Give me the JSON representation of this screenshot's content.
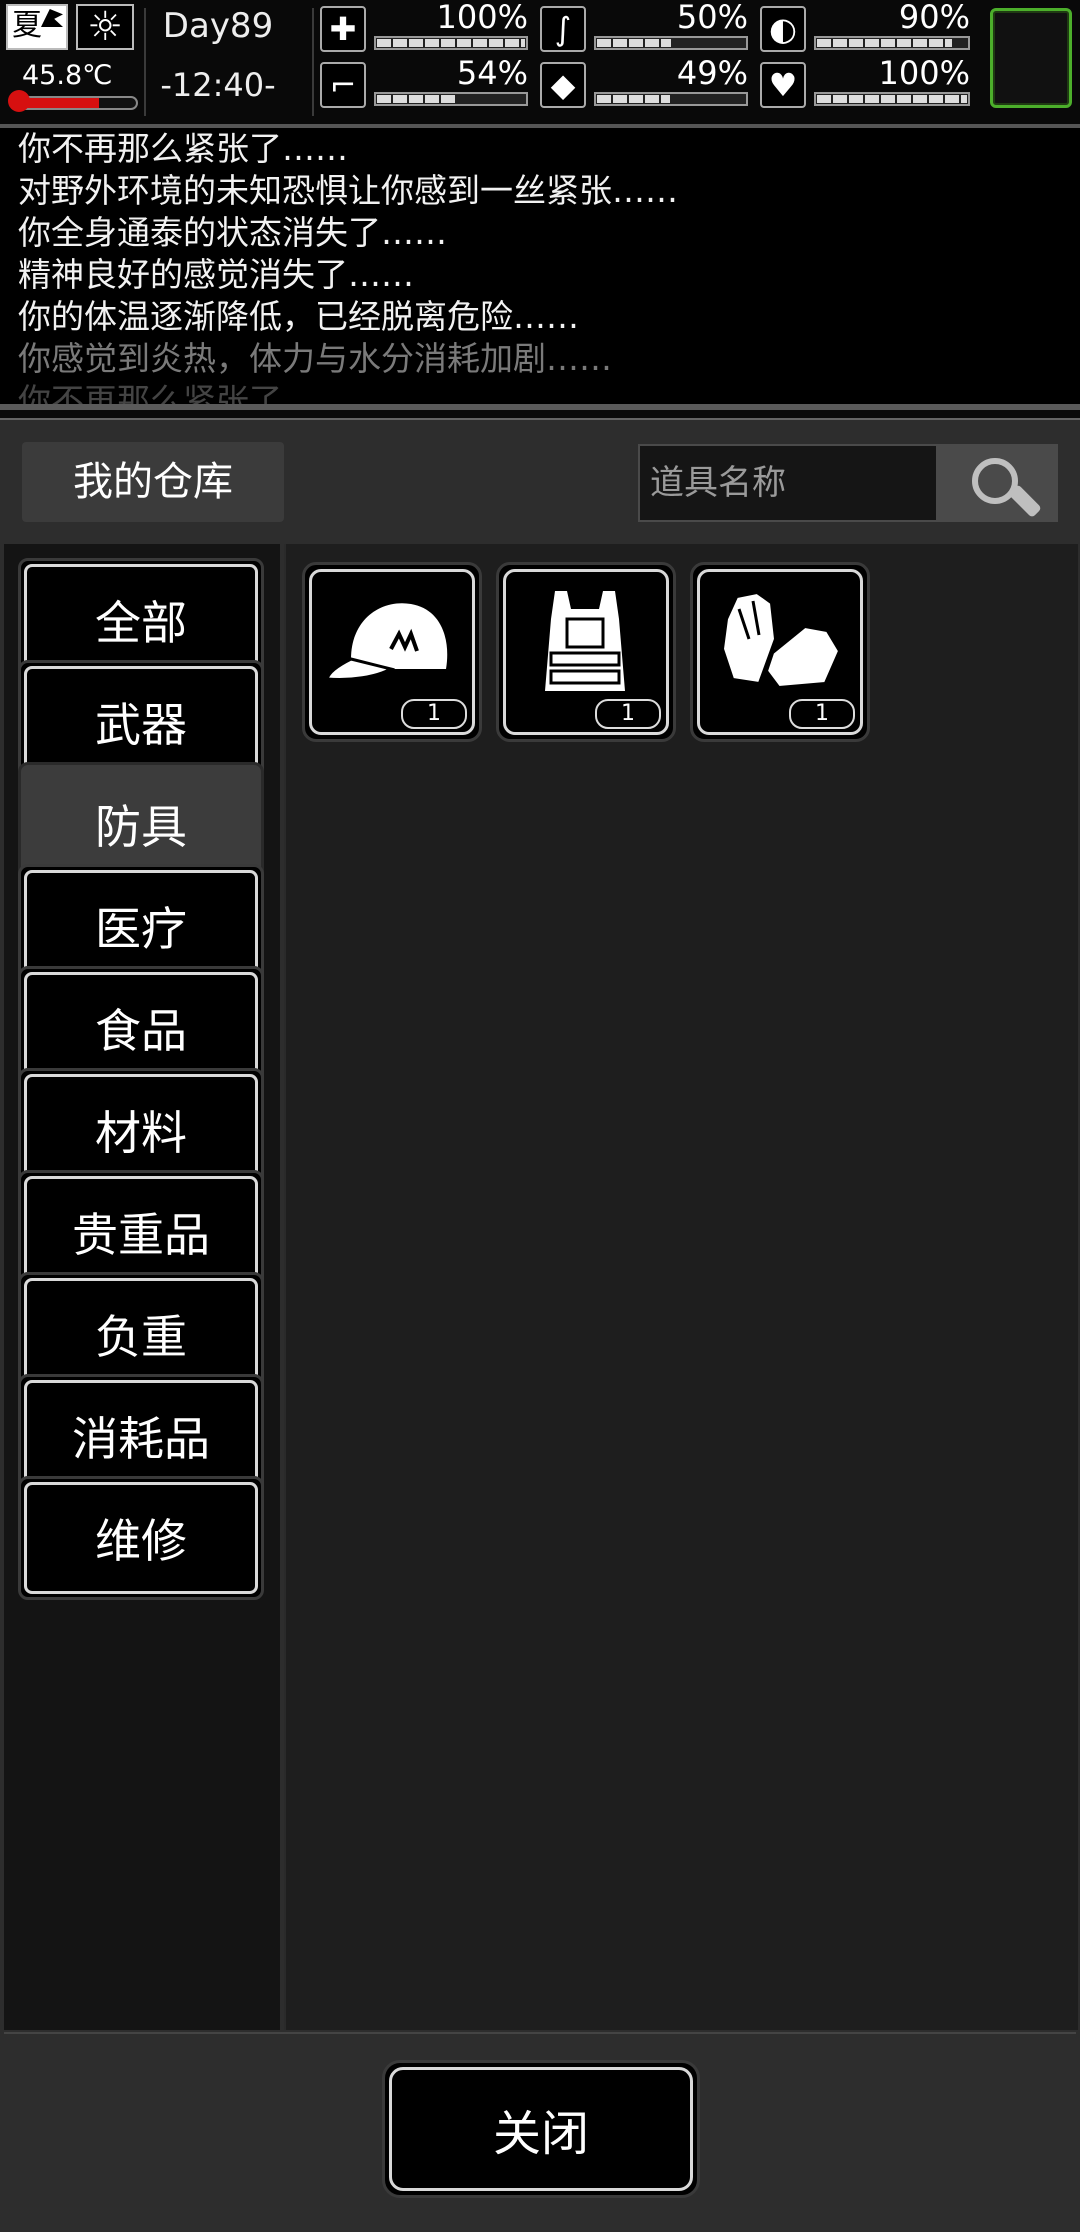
{
  "hud": {
    "season": "夏",
    "weather_icon": "☼",
    "temperature": "45.8℃",
    "temperature_fill_percent": 70,
    "day": "Day89",
    "time": "-12:40-",
    "stats": [
      {
        "name": "health",
        "icon": "medkit-icon",
        "glyph": "✚",
        "value": "100%",
        "level": 100
      },
      {
        "name": "hunger",
        "icon": "stomach-icon",
        "glyph": "∫",
        "value": "50%",
        "level": 50
      },
      {
        "name": "energy",
        "icon": "pill-icon",
        "glyph": "◐",
        "value": "90%",
        "level": 90
      },
      {
        "name": "stamina",
        "icon": "foot-icon",
        "glyph": "⌐",
        "value": "54%",
        "level": 54
      },
      {
        "name": "thirst",
        "icon": "water-drop-icon",
        "glyph": "◆",
        "value": "49%",
        "level": 49
      },
      {
        "name": "mood",
        "icon": "heart-icon",
        "glyph": "♥",
        "value": "100%",
        "level": 100
      }
    ]
  },
  "log": {
    "lines": [
      "你不再那么紧张了……",
      "对野外环境的未知恐惧让你感到一丝紧张……",
      "你全身通泰的状态消失了……",
      "精神良好的感觉消失了……",
      "你的体温逐渐降低，已经脱离危险……",
      "你感觉到炎热，体力与水分消耗加剧……",
      "你不再那么紧张了……"
    ]
  },
  "warehouse": {
    "title": "我的仓库",
    "search_placeholder": "道具名称",
    "categories": [
      "全部",
      "武器",
      "防具",
      "医疗",
      "食品",
      "材料",
      "贵重品",
      "负重",
      "消耗品",
      "维修"
    ],
    "active_category": "防具",
    "items": [
      {
        "name": "cap",
        "icon": "baseball-cap-icon",
        "quantity": "1"
      },
      {
        "name": "vest",
        "icon": "body-armor-vest-icon",
        "quantity": "1"
      },
      {
        "name": "gloves",
        "icon": "gloves-icon",
        "quantity": "1"
      }
    ],
    "close_label": "关闭"
  },
  "colors": {
    "accent_green": "#4caf2b",
    "thermo_red": "#d61010"
  }
}
